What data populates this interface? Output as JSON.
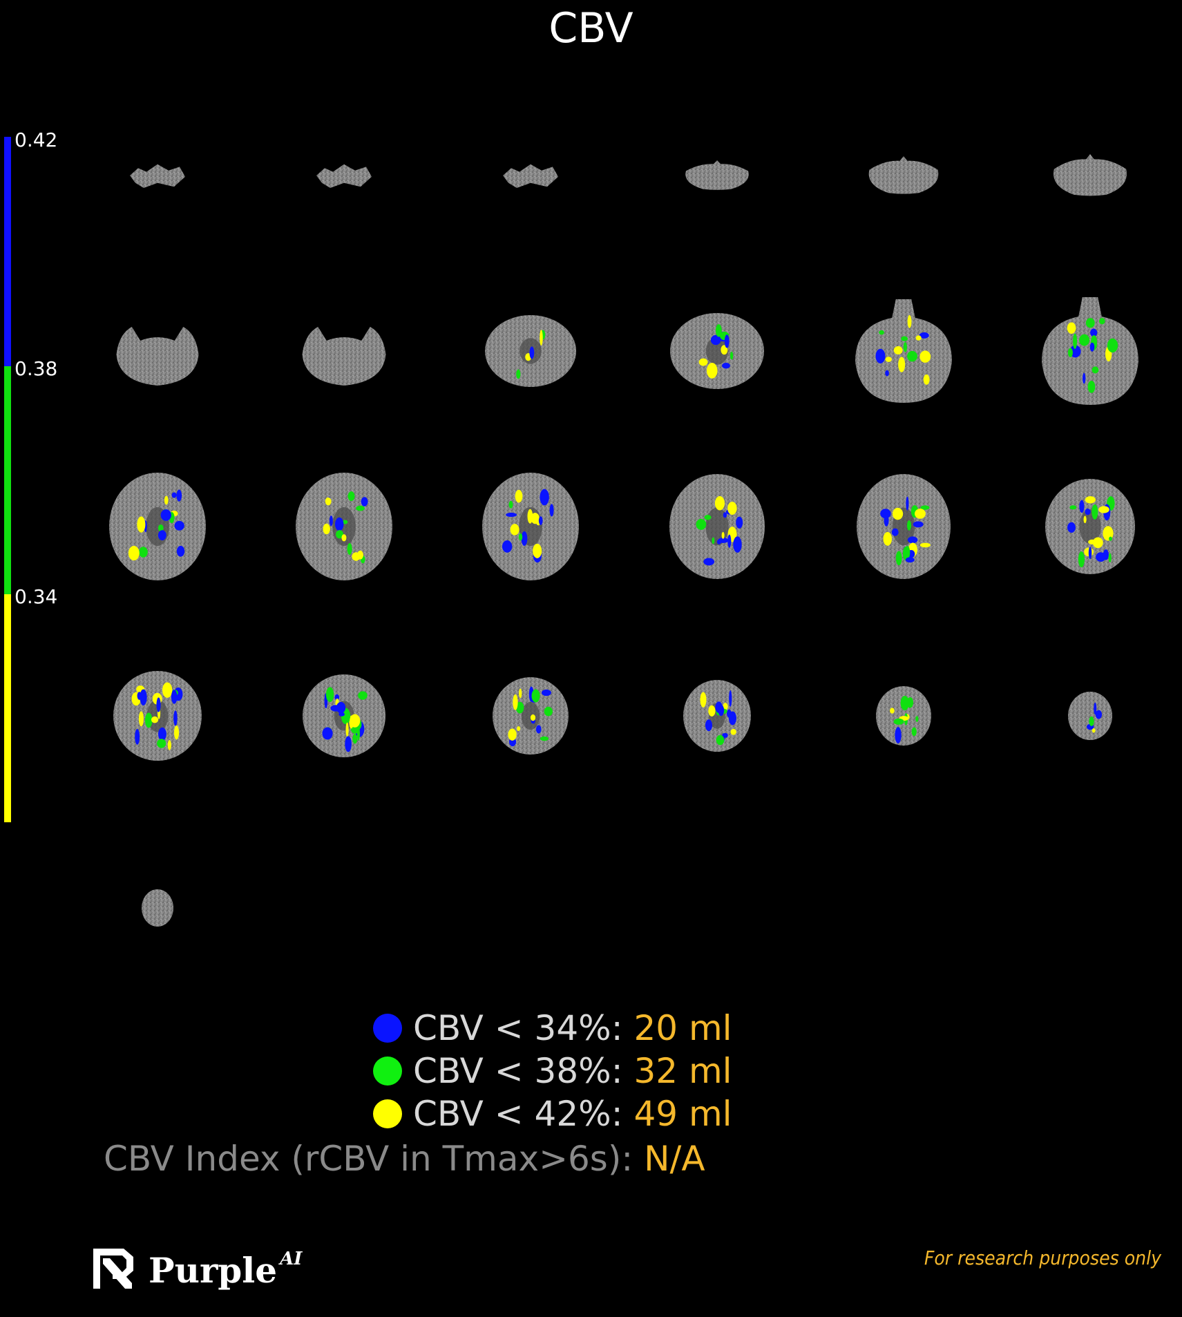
{
  "title": "CBV",
  "colorbar": {
    "ticks": [
      "0.42",
      "0.38",
      "0.34"
    ],
    "colors": {
      "top": "#1010ff",
      "middle": "#10e010",
      "bottom": "#ffff00"
    }
  },
  "legend": [
    {
      "color": "#0a14ff",
      "label": "CBV < 34%:",
      "value": "20 ml"
    },
    {
      "color": "#10f010",
      "label": "CBV < 38%:",
      "value": "32 ml"
    },
    {
      "color": "#ffff00",
      "label": "CBV < 42%:",
      "value": "49 ml"
    }
  ],
  "index": {
    "label": "CBV Index (rCBV in Tmax>6s):",
    "value": "N/A"
  },
  "logo": {
    "name": "Purple",
    "suffix": "AI",
    "icon": "purple-logo-icon"
  },
  "disclaimer": "For research purposes only",
  "slices": {
    "rows": 5,
    "cols": 6,
    "count": 25
  }
}
